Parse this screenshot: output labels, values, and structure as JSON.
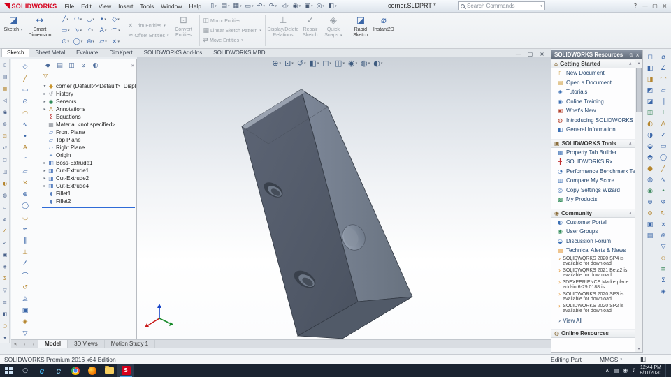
{
  "colors": {
    "accent_blue": "#2e6fd0",
    "logo_red": "#d6001c",
    "alert_orange": "#e08a1e",
    "taskbar_dark": "#1b2431"
  },
  "title_bar": {
    "logo_text": "SOLIDWORKS",
    "logo_mark": "◥",
    "menus": [
      "File",
      "Edit",
      "View",
      "Insert",
      "Tools",
      "Window",
      "Help"
    ],
    "toolbar_icons": [
      {
        "name": "new-document-icon",
        "glyph": "▯"
      },
      {
        "name": "open-icon",
        "glyph": "▤"
      },
      {
        "name": "save-icon",
        "glyph": "▦"
      },
      {
        "name": "print-icon",
        "glyph": "▭"
      },
      {
        "name": "undo-icon",
        "glyph": "↶"
      },
      {
        "name": "redo-icon",
        "glyph": "↷"
      },
      {
        "name": "select-icon",
        "glyph": "◁"
      },
      {
        "name": "rebuild-icon",
        "glyph": "◉"
      },
      {
        "name": "file-properties-icon",
        "glyph": "▣"
      },
      {
        "name": "options-icon",
        "glyph": "◎"
      },
      {
        "name": "edit-appearance-icon",
        "glyph": "◧"
      }
    ],
    "document_title": "corner.SLDPRT *",
    "search_placeholder": "Search Commands",
    "window_controls": {
      "help": "?",
      "minimize": "—",
      "maximize": "▢",
      "close": "×"
    }
  },
  "ribbon": {
    "sketch": {
      "label": "Sketch",
      "glyph": "◪"
    },
    "smart_dimension": {
      "label": "Smart Dimension",
      "glyph": "↔"
    },
    "entity_grid": [
      "╱",
      "▭",
      "⊙",
      "◠",
      "∿",
      "◯",
      "◡",
      "◜",
      "⊕",
      "•",
      "A",
      "▱",
      "◇",
      "⌒",
      "×"
    ],
    "trim": {
      "label": "Trim Entities",
      "glyph": "×"
    },
    "offset": {
      "label": "Offset Entities",
      "glyph": "≈"
    },
    "convert": {
      "label": "Convert Entities",
      "glyph": "⊡"
    },
    "mirror": {
      "label": "Mirror Entities",
      "glyph": "◫"
    },
    "linear_pattern": {
      "label": "Linear Sketch Pattern",
      "glyph": "▦"
    },
    "move": {
      "label": "Move Entities",
      "glyph": "⇄"
    },
    "display_delete": {
      "label": "Display/Delete Relations",
      "glyph": "⊥"
    },
    "repair": {
      "label": "Repair Sketch",
      "glyph": "✓"
    },
    "quick_snaps": {
      "label": "Quick Snaps",
      "glyph": "◈"
    },
    "rapid_sketch": {
      "label": "Rapid Sketch",
      "glyph": "◪"
    },
    "instant2d": {
      "label": "Instant2D",
      "glyph": "⌀"
    }
  },
  "tab_bar": {
    "active_index": 0,
    "tabs": [
      {
        "label": "Sketch"
      },
      {
        "label": "Sheet Metal"
      },
      {
        "label": "Evaluate"
      },
      {
        "label": "DimXpert"
      },
      {
        "label": "SOLIDWORKS Add-Ins"
      },
      {
        "label": "SOLIDWORKS MBD"
      }
    ]
  },
  "hud_icons": [
    {
      "name": "zoom-fit-icon",
      "glyph": "⊕"
    },
    {
      "name": "zoom-area-icon",
      "glyph": "⊡"
    },
    {
      "name": "previous-view-icon",
      "glyph": "↺"
    },
    {
      "name": "section-view-icon",
      "glyph": "◧"
    },
    {
      "name": "view-orientation-icon",
      "glyph": "◻"
    },
    {
      "name": "display-style-icon",
      "glyph": "◫"
    },
    {
      "name": "hide-show-items-icon",
      "glyph": "◉"
    },
    {
      "name": "edit-appearance-icon",
      "glyph": "◍"
    },
    {
      "name": "apply-scene-icon",
      "glyph": "◐"
    }
  ],
  "doc_window_controls": {
    "minimize": "—",
    "restore": "▢",
    "close": "×"
  },
  "feature_panel": {
    "tabs": [
      {
        "name": "featuremanager-tab",
        "glyph": "◆"
      },
      {
        "name": "propertymanager-tab",
        "glyph": "▤"
      },
      {
        "name": "configurationmanager-tab",
        "glyph": "◫"
      },
      {
        "name": "dimxpertmanager-tab",
        "glyph": "⌀"
      },
      {
        "name": "displaymanager-tab",
        "glyph": "◐"
      }
    ],
    "overflow_arrow": "»",
    "filter_icon": "▽",
    "root": {
      "label": "corner (Default<<Default>_Display State",
      "glyph": "◆",
      "color": "#c9952e",
      "arrow": "▾"
    },
    "items": [
      {
        "label": "History",
        "glyph": "↺",
        "color": "#8a8f98",
        "arrow": "▸"
      },
      {
        "label": "Sensors",
        "glyph": "◉",
        "color": "#2e8a57",
        "arrow": "▸"
      },
      {
        "label": "Annotations",
        "glyph": "A",
        "color": "#b5862f",
        "arrow": "▸"
      },
      {
        "label": "Equations",
        "glyph": "Σ",
        "color": "#c03030",
        "arrow": ""
      },
      {
        "label": "Material <not specified>",
        "glyph": "▦",
        "color": "#8a8f98",
        "arrow": ""
      },
      {
        "label": "Front Plane",
        "glyph": "▱",
        "color": "#5b82c0",
        "arrow": ""
      },
      {
        "label": "Top Plane",
        "glyph": "▱",
        "color": "#5b82c0",
        "arrow": ""
      },
      {
        "label": "Right Plane",
        "glyph": "▱",
        "color": "#5b82c0",
        "arrow": ""
      },
      {
        "label": "Origin",
        "glyph": "⌖",
        "color": "#3b6fb4",
        "arrow": ""
      },
      {
        "label": "Boss-Extrude1",
        "glyph": "◧",
        "color": "#5b82c0",
        "arrow": "▸"
      },
      {
        "label": "Cut-Extrude1",
        "glyph": "◨",
        "color": "#5b82c0",
        "arrow": "▸"
      },
      {
        "label": "Cut-Extrude2",
        "glyph": "◨",
        "color": "#5b82c0",
        "arrow": "▸"
      },
      {
        "label": "Cut-Extrude4",
        "glyph": "◨",
        "color": "#5b82c0",
        "arrow": "▸"
      },
      {
        "label": "Fillet1",
        "glyph": "◖",
        "color": "#5b82c0",
        "arrow": ""
      },
      {
        "label": "Fillet2",
        "glyph": "◖",
        "color": "#5b82c0",
        "arrow": ""
      }
    ]
  },
  "resources": {
    "title": "SOLIDWORKS Resources",
    "header_icons": [
      {
        "name": "pin-icon",
        "glyph": "⊙"
      },
      {
        "name": "close-icon",
        "glyph": "×"
      }
    ],
    "getting_started": {
      "title": "Getting Started",
      "icon": "⌂",
      "collapse_icon": "∧",
      "items": [
        {
          "label": "New Document",
          "glyph": "▯",
          "color": "#c9952e"
        },
        {
          "label": "Open a Document",
          "glyph": "▤",
          "color": "#c9952e"
        },
        {
          "label": "Tutorials",
          "glyph": "◈",
          "color": "#3b6fb4"
        },
        {
          "label": "Online Training",
          "glyph": "◉",
          "color": "#3b6fb4"
        },
        {
          "label": "What's New",
          "glyph": "▣",
          "color": "#b5432e"
        },
        {
          "label": "Introducing SOLIDWORKS",
          "glyph": "◍",
          "color": "#b5432e"
        },
        {
          "label": "General Information",
          "glyph": "◧",
          "color": "#3b6fb4"
        }
      ]
    },
    "tools": {
      "title": "SOLIDWORKS Tools",
      "icon": "▣",
      "collapse_icon": "∧",
      "items": [
        {
          "label": "Property Tab Builder",
          "glyph": "▦",
          "color": "#3b6fb4"
        },
        {
          "label": "SOLIDWORKS Rx",
          "glyph": "╋",
          "color": "#c03030"
        },
        {
          "label": "Performance Benchmark Test",
          "glyph": "◔",
          "color": "#3b6fb4"
        },
        {
          "label": "Compare My Score",
          "glyph": "▥",
          "color": "#3b6fb4"
        },
        {
          "label": "Copy Settings Wizard",
          "glyph": "◎",
          "color": "#3b6fb4"
        },
        {
          "label": "My Products",
          "glyph": "▩",
          "color": "#2e8a57"
        }
      ]
    },
    "community": {
      "title": "Community",
      "icon": "◉",
      "collapse_icon": "∧",
      "items": [
        {
          "label": "Customer Portal",
          "glyph": "◐",
          "color": "#3b6fb4"
        },
        {
          "label": "User Groups",
          "glyph": "◉",
          "color": "#2e8a57"
        },
        {
          "label": "Discussion Forum",
          "glyph": "◒",
          "color": "#3b6fb4"
        },
        {
          "label": "Technical Alerts & News",
          "glyph": "▤",
          "color": "#e08a1e"
        }
      ]
    },
    "news": [
      {
        "text": "SOLIDWORKS 2020 SP4 is available for download"
      },
      {
        "text": "SOLIDWORKS 2021 Beta2 is available for download"
      },
      {
        "text": "3DEXPERIENCE Marketplace add-in 6-29.0188 is ..."
      },
      {
        "text": "SOLIDWORKS 2020 SP3 is available for download"
      },
      {
        "text": "SOLIDWORKS 2020 SP2 is available for download"
      }
    ],
    "view_all": "View All",
    "view_all_bullet": "›",
    "online_resources": {
      "title": "Online Resources",
      "icon": "◍"
    }
  },
  "left_toolbar_icons": [
    "▯",
    "▤",
    "▦",
    "◁",
    "◉",
    "⊕",
    "⊡",
    "↺",
    "◻",
    "◫",
    "◐",
    "◍",
    "▱",
    "⌀",
    "∠",
    "✓",
    "▣",
    "◈",
    "Σ",
    "▽",
    "≡",
    "◧",
    "○",
    "▾"
  ],
  "sketch_toolbar_icons": [
    "◇",
    "╱",
    "▭",
    "⊙",
    "◠",
    "∿",
    "•",
    "A",
    "◜",
    "▱",
    "×",
    "⊕",
    "◯",
    "◡",
    "≈",
    "∥",
    "⊥",
    "∠",
    "⌒",
    "↺",
    "◬",
    "▣",
    "◈",
    "▽"
  ],
  "right_toolbar_a": [
    "◻",
    "◧",
    "◨",
    "◩",
    "◪",
    "◫",
    "◐",
    "◑",
    "◒",
    "◓",
    "●",
    "◍",
    "◉",
    "⊕",
    "⊙",
    "▣",
    "▤"
  ],
  "right_toolbar_b": [
    "⌀",
    "∠",
    "⌒",
    "▱",
    "∥",
    "⊥",
    "A",
    "✓",
    "▭",
    "◯",
    "╱",
    "∿",
    "•",
    "↺",
    "↻",
    "×",
    "⊕",
    "▽",
    "◇",
    "≡",
    "Σ",
    "◈"
  ],
  "bottom_tabs": {
    "active_index": 0,
    "nav": [
      "«",
      "‹",
      "›"
    ],
    "tabs": [
      {
        "label": "Model"
      },
      {
        "label": "3D Views"
      },
      {
        "label": "Motion Study 1"
      }
    ]
  },
  "status_bar": {
    "left": "SOLIDWORKS Premium 2016 x64 Edition",
    "editing": "Editing Part",
    "units": "MMGS",
    "units_caret": "▾",
    "badge": "◧"
  },
  "taskbar": {
    "search_glyph": "○",
    "edge_glyph": "e",
    "ie_glyph": "e",
    "sw_glyph": "S",
    "tray_icons": [
      "∧",
      "▤",
      "◉",
      "♪"
    ],
    "time": "12:44 PM",
    "date": "8/11/2020"
  }
}
